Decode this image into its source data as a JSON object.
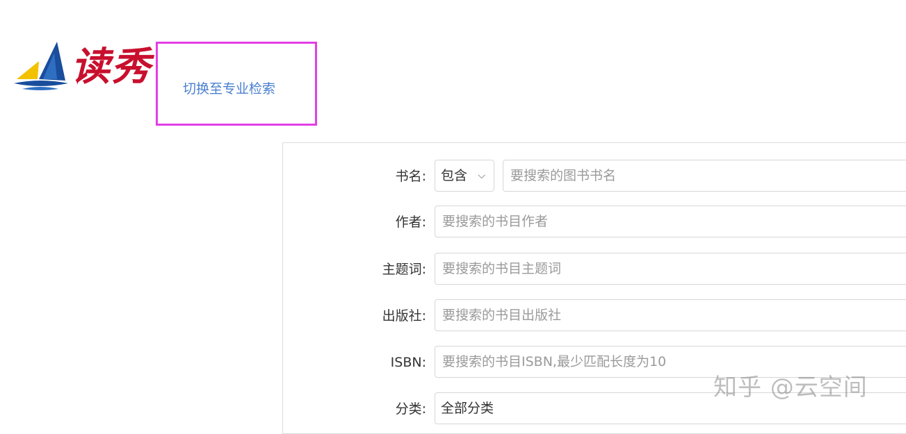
{
  "brand": {
    "name": "读秀",
    "colors": {
      "red": "#c8102e",
      "blue": "#1a4d9c",
      "yellow": "#f2c200"
    }
  },
  "switch_link": {
    "label": "切换至专业检索",
    "color": "#4a7fd0",
    "highlight_color": "#e23ee6"
  },
  "form": {
    "title_row": {
      "label": "书名:",
      "match_select": "包含",
      "placeholder": "要搜索的图书书名"
    },
    "author_row": {
      "label": "作者:",
      "placeholder": "要搜索的书目作者"
    },
    "subject_row": {
      "label": "主题词:",
      "placeholder": "要搜索的书目主题词"
    },
    "publisher_row": {
      "label": "出版社:",
      "placeholder": "要搜索的书目出版社"
    },
    "isbn_row": {
      "label": "ISBN:",
      "placeholder": "要搜索的书目ISBN,最少匹配长度为10"
    },
    "category_row": {
      "label": "分类:",
      "value": "全部分类"
    }
  },
  "icons": {
    "chevron": "chevron-down-icon",
    "logo": "sailboat-logo-icon"
  },
  "watermark": "知乎 @云空间"
}
